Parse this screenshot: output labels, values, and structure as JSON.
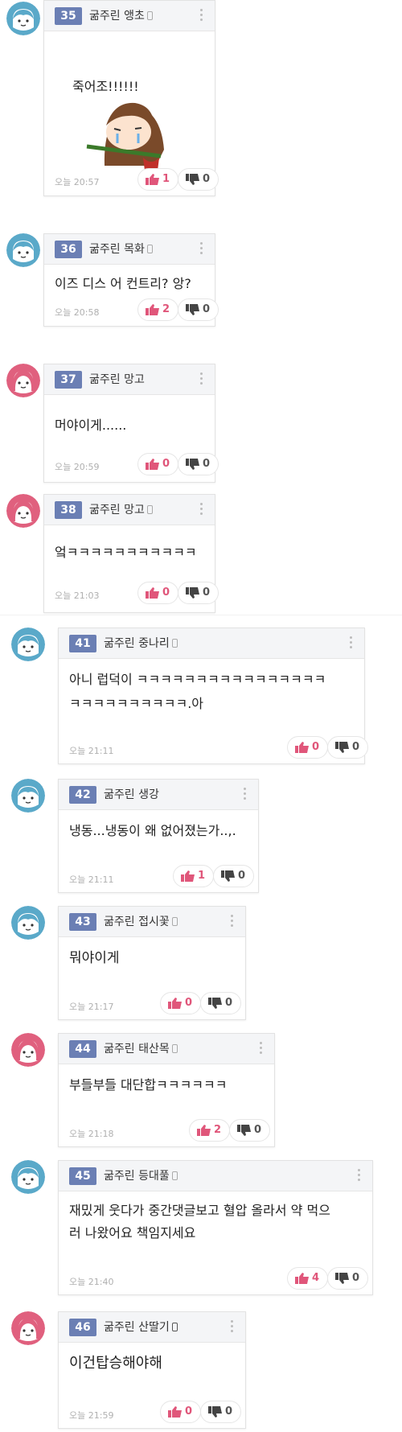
{
  "comments": [
    {
      "num": "35",
      "author": "굶주린 앵초",
      "text": "",
      "image_caption": "죽어조!!!!!!",
      "time": "오늘 20:57",
      "likes": "1",
      "dislikes": "0",
      "avatar": "blue"
    },
    {
      "num": "36",
      "author": "굶주린 목화",
      "text": "이즈 디스 어 컨트리? 앙?",
      "time": "오늘 20:58",
      "likes": "2",
      "dislikes": "0",
      "avatar": "blue"
    },
    {
      "num": "37",
      "author": "굶주린 망고",
      "text": "머야이게......",
      "time": "오늘 20:59",
      "likes": "0",
      "dislikes": "0",
      "avatar": "pink"
    },
    {
      "num": "38",
      "author": "굶주린 망고",
      "text": "엌ㅋㅋㅋㅋㅋㅋㅋㅋㅋㅋㅋ",
      "time": "오늘 21:03",
      "likes": "0",
      "dislikes": "0",
      "avatar": "pink"
    },
    {
      "num": "41",
      "author": "굶주린 중나리",
      "text": "아니 럽덕이 ㅋㅋㅋㅋㅋㅋㅋㅋㅋㅋㅋㅋㅋㅋㅋㅋ",
      "text2": "ㅋㅋㅋㅋㅋㅋㅋㅋㅋㅋ.아",
      "time": "오늘 21:11",
      "likes": "0",
      "dislikes": "0",
      "avatar": "blue"
    },
    {
      "num": "42",
      "author": "굶주린 생강",
      "text": "냉동...냉동이 왜 없어졌는가..,.",
      "time": "오늘 21:11",
      "likes": "1",
      "dislikes": "0",
      "avatar": "blue"
    },
    {
      "num": "43",
      "author": "굶주린 접시꽃",
      "text": "뭐야이게",
      "time": "오늘 21:17",
      "likes": "0",
      "dislikes": "0",
      "avatar": "blue"
    },
    {
      "num": "44",
      "author": "굶주린 태산목",
      "text": "부들부들 대단합ㅋㅋㅋㅋㅋㅋ",
      "time": "오늘 21:18",
      "likes": "2",
      "dislikes": "0",
      "avatar": "pink"
    },
    {
      "num": "45",
      "author": "굶주린 등대풀",
      "text": "재밌게 웃다가 중간댓글보고 혈압 올라서 약 먹으",
      "text2": "러 나왔어요 책임지세요",
      "time": "오늘 21:40",
      "likes": "4",
      "dislikes": "0",
      "avatar": "blue"
    },
    {
      "num": "46",
      "author": "굶주린 산딸기",
      "text": "이건탑승해야해",
      "time": "오늘 21:59",
      "likes": "0",
      "dislikes": "0",
      "avatar": "pink"
    }
  ],
  "colors": {
    "number_badge": "#6b7fb4",
    "like": "#e0567a",
    "avatar_blue": "#5aa9c9",
    "avatar_pink": "#e0607e"
  }
}
